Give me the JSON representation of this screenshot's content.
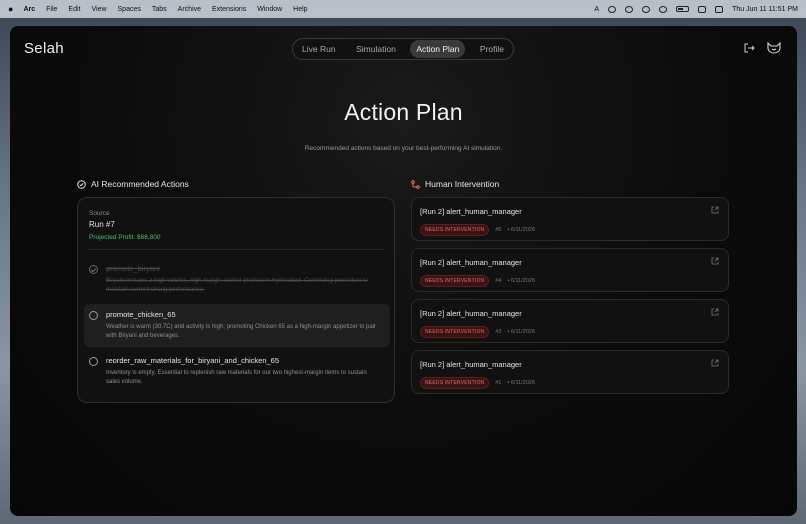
{
  "menubar": {
    "app": "Arc",
    "menus": [
      "File",
      "Edit",
      "View",
      "Spaces",
      "Tabs",
      "Archive",
      "Extensions",
      "Window",
      "Help"
    ],
    "clock": "Thu Jun 11  11:51 PM"
  },
  "brand": "Selah",
  "nav": {
    "tabs": [
      {
        "label": "Live Run",
        "active": false
      },
      {
        "label": "Simulation",
        "active": false
      },
      {
        "label": "Action Plan",
        "active": true
      },
      {
        "label": "Profile",
        "active": false
      }
    ]
  },
  "page": {
    "title": "Action Plan",
    "subtitle": "Recommended actions based on your best-performing AI simulation."
  },
  "recommended": {
    "heading": "AI Recommended Actions",
    "source_label": "Source",
    "run": "Run #7",
    "profit": "Projected Profit: $66,800",
    "actions": [
      {
        "name": "promote_biryani",
        "desc": "Biryani remains a high-volume, high-margin anchor product in Hyderabad. Continuing promotion to maintain current strong performance.",
        "done": true
      },
      {
        "name": "promote_chicken_65",
        "desc": "Weather is warm (30.7C) and activity is high; promoting Chicken 65 as a high-margin appetizer to pair with Biryani and beverages.",
        "done": false
      },
      {
        "name": "reorder_raw_materials_for_biryani_and_chicken_65",
        "desc": "Inventory is empty. Essential to replenish raw materials for our two highest-margin items to sustain sales volume.",
        "done": false
      }
    ]
  },
  "intervention": {
    "heading": "Human Intervention",
    "items": [
      {
        "title": "[Run 2] alert_human_manager",
        "badge": "NEEDS INTERVENTION",
        "num": "#5",
        "date": "• 6/11/2026"
      },
      {
        "title": "[Run 2] alert_human_manager",
        "badge": "NEEDS INTERVENTION",
        "num": "#4",
        "date": "• 6/11/2026"
      },
      {
        "title": "[Run 2] alert_human_manager",
        "badge": "NEEDS INTERVENTION",
        "num": "#3",
        "date": "• 6/11/2026"
      },
      {
        "title": "[Run 2] alert_human_manager",
        "badge": "NEEDS INTERVENTION",
        "num": "#1",
        "date": "• 6/11/2026"
      }
    ]
  }
}
